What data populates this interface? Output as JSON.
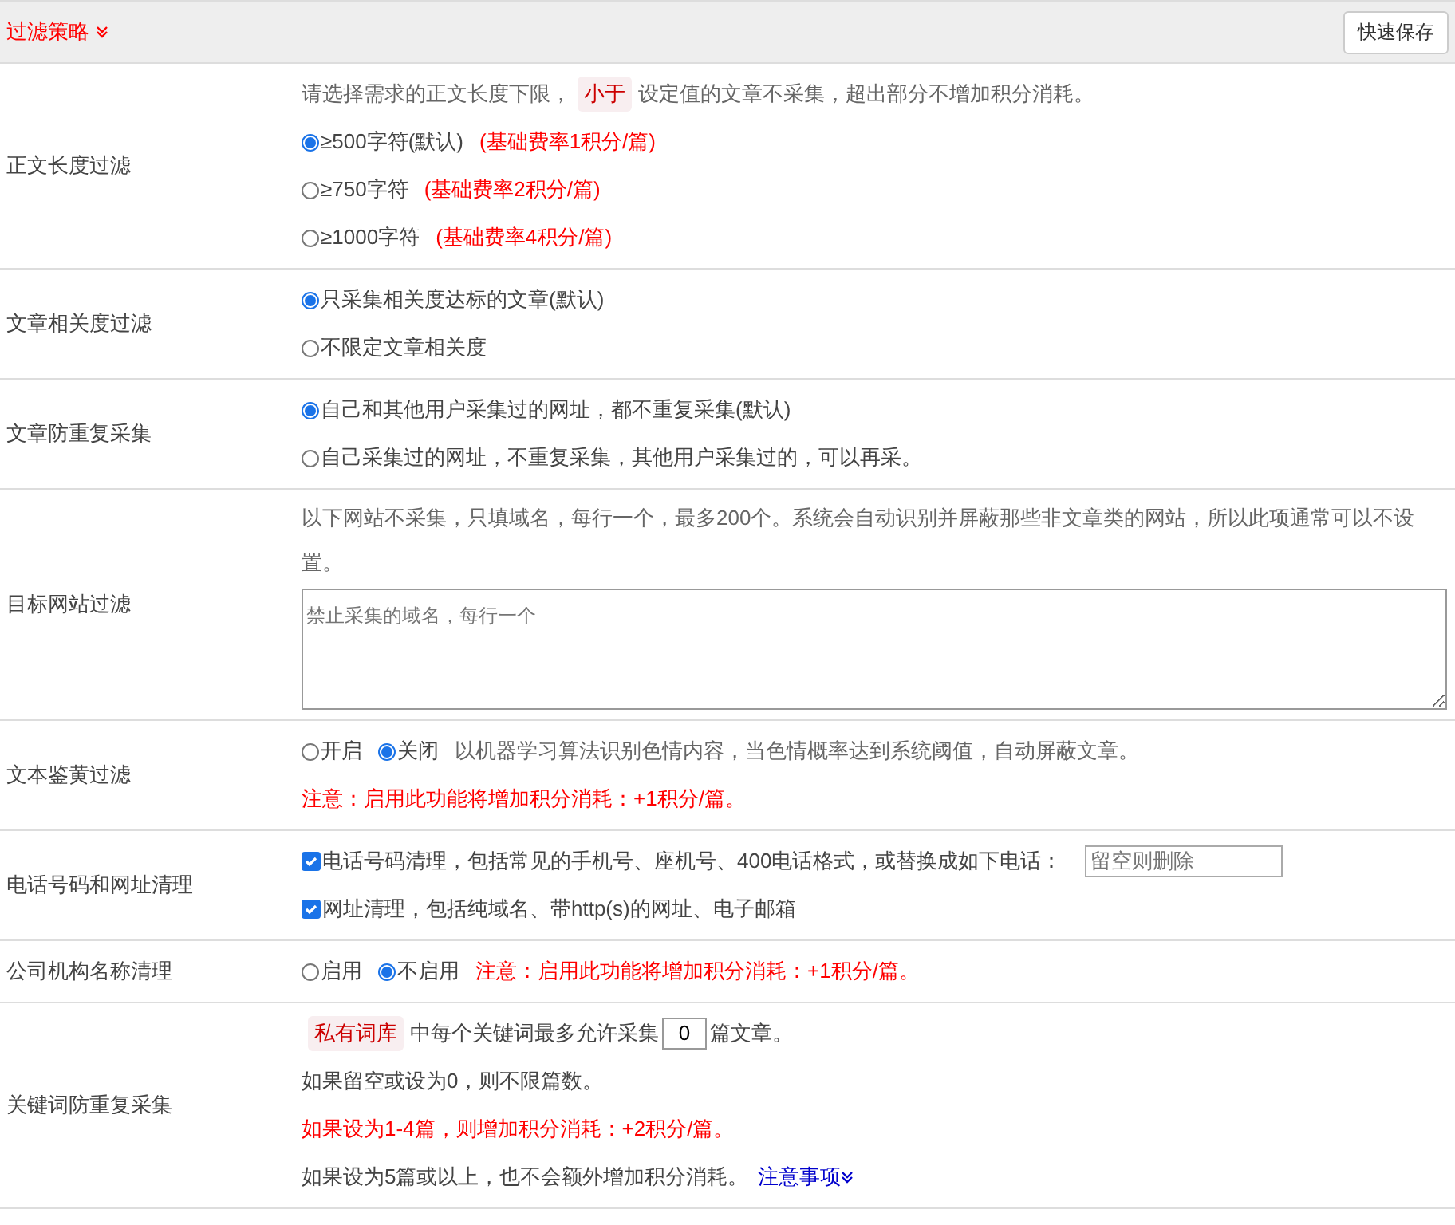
{
  "header": {
    "title": "过滤策略",
    "button": "快速保存"
  },
  "rows": [
    {
      "label": "正文长度过滤",
      "lines": [
        [
          {
            "kind": "hint",
            "text": "请选择需求的正文长度下限，"
          },
          {
            "kind": "tag",
            "text": "小于"
          },
          {
            "kind": "hint",
            "text": "设定值的文章不采集，超出部分不增加积分消耗。"
          }
        ],
        [
          {
            "kind": "radio",
            "label": "≥500字符(默认)",
            "selected": true
          },
          {
            "kind": "note",
            "text": "(基础费率1积分/篇)"
          }
        ],
        [
          {
            "kind": "radio",
            "label": "≥750字符",
            "selected": false
          },
          {
            "kind": "note",
            "text": "(基础费率2积分/篇)"
          }
        ],
        [
          {
            "kind": "radio",
            "label": "≥1000字符",
            "selected": false
          },
          {
            "kind": "note",
            "text": "(基础费率4积分/篇)"
          }
        ]
      ]
    },
    {
      "label": "文章相关度过滤",
      "lines": [
        [
          {
            "kind": "radio",
            "label": "只采集相关度达标的文章(默认)",
            "selected": true
          }
        ],
        [
          {
            "kind": "radio",
            "label": "不限定文章相关度",
            "selected": false
          }
        ]
      ]
    },
    {
      "label": "文章防重复采集",
      "lines": [
        [
          {
            "kind": "radio",
            "label": "自己和其他用户采集过的网址，都不重复采集(默认)",
            "selected": true
          }
        ],
        [
          {
            "kind": "radio",
            "label": "自己采集过的网址，不重复采集，其他用户采集过的，可以再采。",
            "selected": false
          }
        ]
      ]
    },
    {
      "label": "目标网站过滤",
      "lines": [
        [
          {
            "kind": "hint",
            "text": "以下网站不采集，只填域名，每行一个，最多200个。系统会自动识别并屏蔽那些非文章类的网站，所以此项通常可以不设置。"
          }
        ],
        [
          {
            "kind": "textarea",
            "placeholder": "禁止采集的域名，每行一个"
          }
        ]
      ]
    },
    {
      "label": "文本鉴黄过滤",
      "lines": [
        [
          {
            "kind": "radio",
            "label": "开启",
            "selected": false
          },
          {
            "kind": "radio",
            "label": "关闭",
            "selected": true
          },
          {
            "kind": "hint",
            "text": "以机器学习算法识别色情内容，当色情概率达到系统阈值，自动屏蔽文章。"
          }
        ],
        [
          {
            "kind": "note",
            "text": "注意：启用此功能将增加积分消耗：+1积分/篇。"
          }
        ]
      ]
    },
    {
      "label": "电话号码和网址清理",
      "lines": [
        [
          {
            "kind": "checkbox",
            "label": "电话号码清理，包括常见的手机号、座机号、400电话格式，或替换成如下电话：",
            "checked": true
          },
          {
            "kind": "input",
            "placeholder": "留空则删除"
          }
        ],
        [
          {
            "kind": "checkbox",
            "label": "网址清理，包括纯域名、带http(s)的网址、电子邮箱",
            "checked": true
          }
        ]
      ]
    },
    {
      "label": "公司机构名称清理",
      "lines": [
        [
          {
            "kind": "radio",
            "label": "启用",
            "selected": false
          },
          {
            "kind": "radio",
            "label": "不启用",
            "selected": true
          },
          {
            "kind": "note",
            "text": "注意：启用此功能将增加积分消耗：+1积分/篇。"
          }
        ]
      ]
    },
    {
      "label": "关键词防重复采集",
      "lines": [
        [
          {
            "kind": "tag",
            "text": "私有词库"
          },
          {
            "kind": "text",
            "text": "中每个关键词最多允许采集"
          },
          {
            "kind": "number",
            "value": "0"
          },
          {
            "kind": "text",
            "text": "篇文章。"
          }
        ],
        [
          {
            "kind": "text",
            "text": "如果留空或设为0，则不限篇数。"
          }
        ],
        [
          {
            "kind": "note",
            "text": "如果设为1-4篇，则增加积分消耗：+2积分/篇。"
          }
        ],
        [
          {
            "kind": "text",
            "text": "如果设为5篇或以上，也不会额外增加积分消耗。"
          },
          {
            "kind": "link",
            "text": "注意事项"
          }
        ]
      ]
    }
  ]
}
